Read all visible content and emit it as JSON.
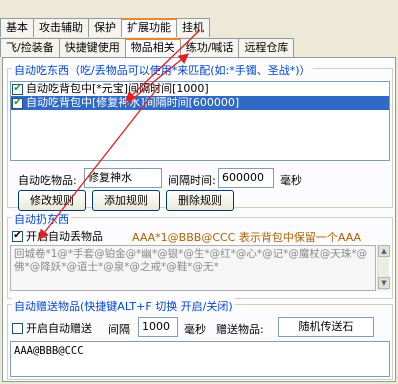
{
  "tabs_row1": [
    "基本",
    "攻击辅助",
    "保护",
    "扩展功能",
    "挂机"
  ],
  "tabs_row2": [
    "飞/捡装备",
    "快捷键使用",
    "物品相关",
    "练功/喊话",
    "远程仓库"
  ],
  "auto_eat": {
    "title": "自动吃东西（吃/丢物品可以使用*来匹配(如:*手镯、圣战*)）",
    "items": [
      "自动吃背包中[*元宝]间隔时间[1000]",
      "自动吃背包中[修复神水]间隔时间[600000]"
    ],
    "item_label": "自动吃物品:",
    "item_value": "修复神水",
    "interval_label": "间隔时间:",
    "interval_value": "600000",
    "unit": "毫秒",
    "btn_modify": "修改规则",
    "btn_add": "添加规则",
    "btn_delete": "删除规则"
  },
  "auto_drop": {
    "title": "自动扔东西",
    "checkbox_label": "开启自动丢物品",
    "hint": "AAA*1@BBB@CCC 表示背包中保留一个AAA",
    "text": "回城卷*1@*手套@铂金@*幽*@银*@生*@红*@心*@记*@魔杖@天珠*@佛*@降妖*@道士*@泉*@之戒*@鞋*@无*"
  },
  "auto_gift": {
    "title": "自动赠送物品(快捷键ALT+F 切换 开启/关闭)",
    "checkbox_label": "开启自动赠送",
    "interval_label": "间隔",
    "interval_value": "1000",
    "unit": "毫秒",
    "gift_label": "赠送物品:",
    "gift_value": "随机传送石",
    "text": "AAA@BBB@CCC"
  },
  "colors": {
    "accent": "#e68b2c",
    "group_title": "#0046d5",
    "hint": "#b06000",
    "arrow": "#e02020"
  }
}
